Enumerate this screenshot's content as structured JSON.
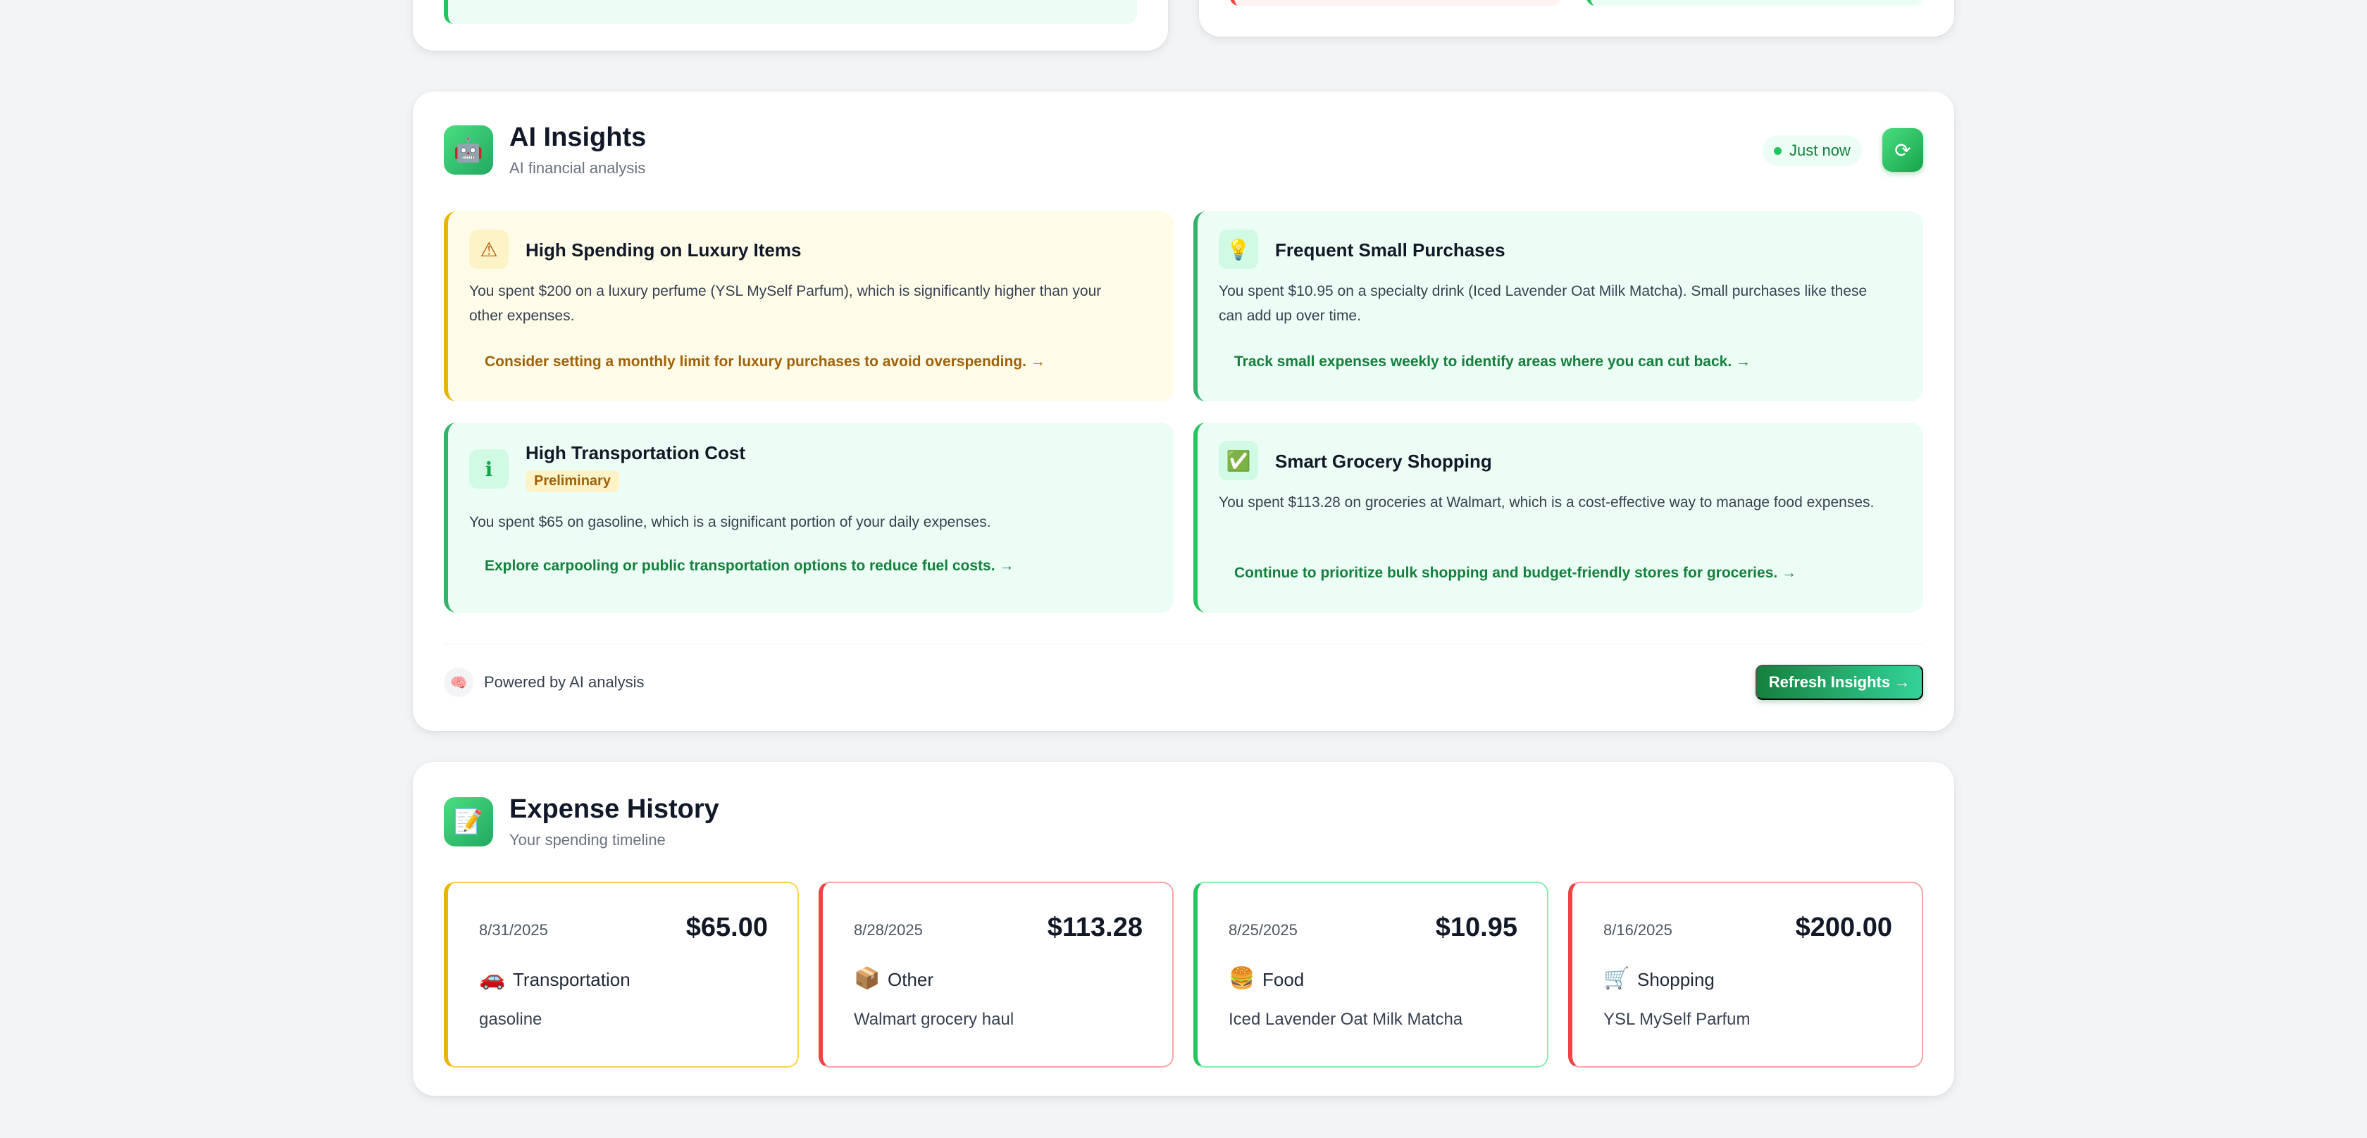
{
  "ai_insights": {
    "title": "AI Insights",
    "subtitle": "AI financial analysis",
    "icon": "robot-icon",
    "status": "Just now",
    "refresh_icon": "refresh-icon",
    "insights": [
      {
        "icon": "warning-icon",
        "icon_glyph": "⚠",
        "title": "High Spending on Luxury Items",
        "text": "You spent $200 on a luxury perfume (YSL MySelf Parfum), which is significantly higher than your other expenses.",
        "action": "Consider setting a monthly limit for luxury purchases to avoid overspending.  →",
        "color": "#eab308"
      },
      {
        "icon": "lightbulb-icon",
        "icon_glyph": "💡",
        "title": "Frequent Small Purchases",
        "text": "You spent $10.95 on a specialty drink (Iced Lavender Oat Milk Matcha). Small purchases like these can add up over time.",
        "action": "Track small expenses weekly to identify areas where you can cut back.  →",
        "color": "#22c55e"
      },
      {
        "icon": "info-icon",
        "icon_glyph": "ℹ",
        "title": "High Transportation Cost",
        "badge": "Preliminary",
        "text": "You spent $65 on gasoline, which is a significant portion of your daily expenses.",
        "action": "Explore carpooling or public transportation options to reduce fuel costs.  →",
        "color": "#22c55e"
      },
      {
        "icon": "check-icon",
        "icon_glyph": "✅",
        "title": "Smart Grocery Shopping",
        "text": "You spent $113.28 on groceries at Walmart, which is a cost-effective way to manage food expenses.",
        "action": "Continue to prioritize bulk shopping and budget-friendly stores for groceries.  →",
        "color": "#22c55e"
      }
    ],
    "footer_text": "Powered by AI analysis",
    "refresh_button": "Refresh Insights →"
  },
  "expense_history": {
    "title": "Expense History",
    "subtitle": "Your spending timeline",
    "icon": "notepad-icon",
    "items": [
      {
        "date": "8/31/2025",
        "amount": "$65.00",
        "category": "Transportation",
        "category_icon": "car-icon",
        "description": "gasoline",
        "color": "#eab308"
      },
      {
        "date": "8/28/2025",
        "amount": "$113.28",
        "category": "Other",
        "category_icon": "package-icon",
        "description": "Walmart grocery haul",
        "color": "#ef4444"
      },
      {
        "date": "8/25/2025",
        "amount": "$10.95",
        "category": "Food",
        "category_icon": "burger-icon",
        "description": "Iced Lavender Oat Milk Matcha",
        "color": "#22c55e"
      },
      {
        "date": "8/16/2025",
        "amount": "$200.00",
        "category": "Shopping",
        "category_icon": "cart-icon",
        "description": "YSL MySelf Parfum",
        "color": "#ef4444"
      }
    ]
  }
}
